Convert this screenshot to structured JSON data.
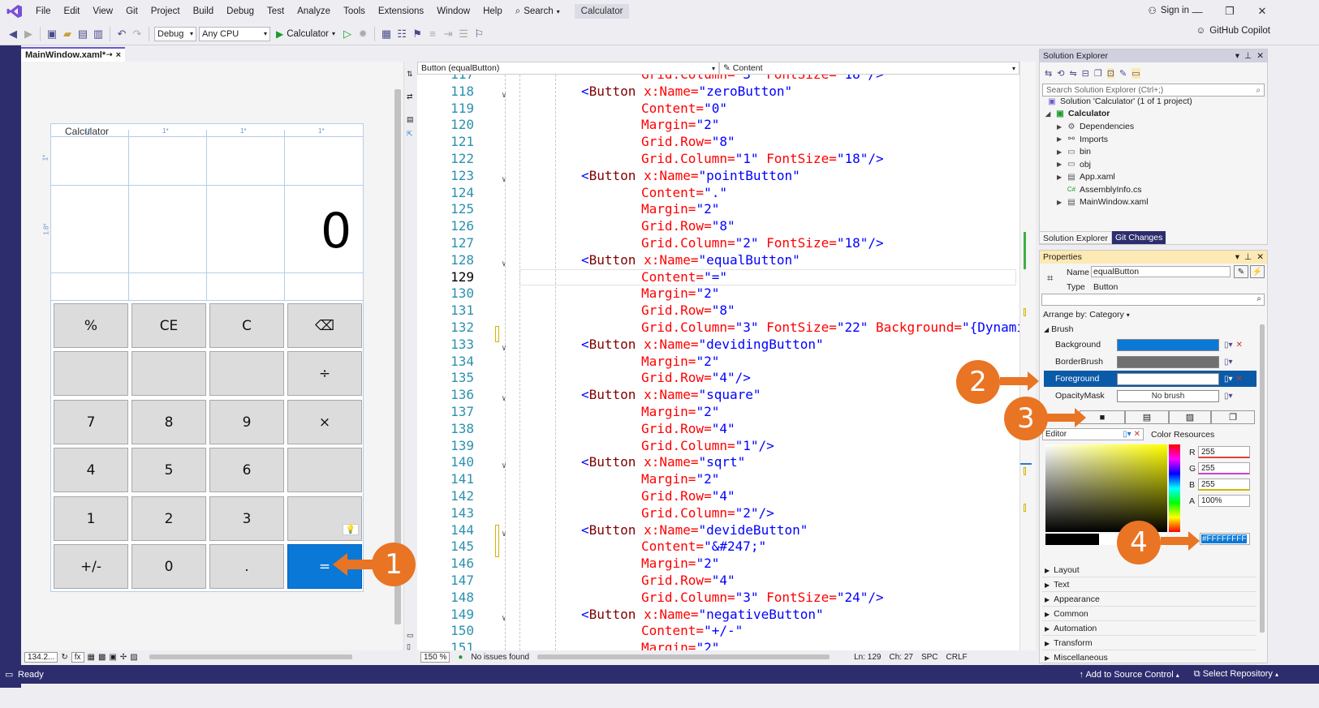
{
  "menu": {
    "items": [
      "File",
      "Edit",
      "View",
      "Git",
      "Project",
      "Build",
      "Debug",
      "Test",
      "Analyze",
      "Tools",
      "Extensions",
      "Window",
      "Help"
    ],
    "search_label": "Search",
    "title_badge": "Calculator",
    "sign_in": "Sign in"
  },
  "toolbar": {
    "config": "Debug",
    "platform": "Any CPU",
    "run_label": "Calculator",
    "copilot": "GitHub Copilot"
  },
  "doc_tab": {
    "label": "MainWindow.xaml*",
    "close": "×"
  },
  "designer": {
    "window_title": "Calculator",
    "display_value": "0",
    "column_markers": [
      "1*",
      "1*",
      "1*",
      "1*"
    ],
    "row_marker_a": "1*",
    "row_marker_b": "1.8*",
    "zoom": "134.2...",
    "buttons": [
      [
        "%",
        "CE",
        "C",
        "⌫"
      ],
      [
        "",
        "",
        "",
        "÷"
      ],
      [
        "7",
        "8",
        "9",
        "×"
      ],
      [
        "4",
        "5",
        "6",
        ""
      ],
      [
        "1",
        "2",
        "3",
        ""
      ],
      [
        "+/-",
        "0",
        ".",
        "="
      ]
    ]
  },
  "editor": {
    "scope_left": "Button (equalButton)",
    "scope_right": "Content",
    "current_line": 129,
    "zoom": "150 %",
    "issues": "No issues found",
    "ln": "Ln: 129",
    "ch": "Ch: 27",
    "spc": "SPC",
    "crlf": "CRLF",
    "lines": [
      {
        "n": "117",
        "parts": [
          [
            "a",
            "Grid.Column="
          ],
          [
            "v",
            "\"3\""
          ],
          [
            "a",
            " FontSize="
          ],
          [
            "v",
            "\"18\""
          ],
          [
            "p",
            "/>"
          ]
        ],
        "indent": 2
      },
      {
        "n": "118",
        "parts": [
          [
            "p",
            "<"
          ],
          [
            "t",
            "Button"
          ],
          [
            "a",
            " x:Name="
          ],
          [
            "v",
            "\"zeroButton\""
          ]
        ],
        "indent": 0,
        "fold": true
      },
      {
        "n": "119",
        "parts": [
          [
            "a",
            "Content="
          ],
          [
            "v",
            "\"0\""
          ]
        ],
        "indent": 2
      },
      {
        "n": "120",
        "parts": [
          [
            "a",
            "Margin="
          ],
          [
            "v",
            "\"2\""
          ]
        ],
        "indent": 2
      },
      {
        "n": "121",
        "parts": [
          [
            "a",
            "Grid.Row="
          ],
          [
            "v",
            "\"8\""
          ]
        ],
        "indent": 2
      },
      {
        "n": "122",
        "parts": [
          [
            "a",
            "Grid.Column="
          ],
          [
            "v",
            "\"1\""
          ],
          [
            "a",
            " FontSize="
          ],
          [
            "v",
            "\"18\""
          ],
          [
            "p",
            "/>"
          ]
        ],
        "indent": 2
      },
      {
        "n": "123",
        "parts": [
          [
            "p",
            "<"
          ],
          [
            "t",
            "Button"
          ],
          [
            "a",
            " x:Name="
          ],
          [
            "v",
            "\"pointButton\""
          ]
        ],
        "indent": 0,
        "fold": true
      },
      {
        "n": "124",
        "parts": [
          [
            "a",
            "Content="
          ],
          [
            "v",
            "\".\""
          ]
        ],
        "indent": 2
      },
      {
        "n": "125",
        "parts": [
          [
            "a",
            "Margin="
          ],
          [
            "v",
            "\"2\""
          ]
        ],
        "indent": 2
      },
      {
        "n": "126",
        "parts": [
          [
            "a",
            "Grid.Row="
          ],
          [
            "v",
            "\"8\""
          ]
        ],
        "indent": 2
      },
      {
        "n": "127",
        "parts": [
          [
            "a",
            "Grid.Column="
          ],
          [
            "v",
            "\"2\""
          ],
          [
            "a",
            " FontSize="
          ],
          [
            "v",
            "\"18\""
          ],
          [
            "p",
            "/>"
          ]
        ],
        "indent": 2
      },
      {
        "n": "128",
        "parts": [
          [
            "p",
            "<"
          ],
          [
            "t",
            "Button"
          ],
          [
            "a",
            " x:Name="
          ],
          [
            "v",
            "\"equalButton\""
          ]
        ],
        "indent": 0,
        "fold": true
      },
      {
        "n": "129",
        "parts": [
          [
            "a",
            "Content="
          ],
          [
            "v",
            "\"=\""
          ]
        ],
        "indent": 2
      },
      {
        "n": "130",
        "parts": [
          [
            "a",
            "Margin="
          ],
          [
            "v",
            "\"2\""
          ]
        ],
        "indent": 2
      },
      {
        "n": "131",
        "parts": [
          [
            "a",
            "Grid.Row="
          ],
          [
            "v",
            "\"8\""
          ]
        ],
        "indent": 2
      },
      {
        "n": "132",
        "parts": [
          [
            "a",
            "Grid.Column="
          ],
          [
            "v",
            "\"3\""
          ],
          [
            "a",
            " FontSize="
          ],
          [
            "v",
            "\"22\""
          ],
          [
            "a",
            " Background="
          ],
          [
            "v",
            "\"{Dynamic"
          ]
        ],
        "indent": 2
      },
      {
        "n": "133",
        "parts": [
          [
            "p",
            "<"
          ],
          [
            "t",
            "Button"
          ],
          [
            "a",
            " x:Name="
          ],
          [
            "v",
            "\"devidingButton\""
          ]
        ],
        "indent": 0,
        "fold": true
      },
      {
        "n": "134",
        "parts": [
          [
            "a",
            "Margin="
          ],
          [
            "v",
            "\"2\""
          ]
        ],
        "indent": 2
      },
      {
        "n": "135",
        "parts": [
          [
            "a",
            "Grid.Row="
          ],
          [
            "v",
            "\"4\""
          ],
          [
            "p",
            "/>"
          ]
        ],
        "indent": 2
      },
      {
        "n": "136",
        "parts": [
          [
            "p",
            "<"
          ],
          [
            "t",
            "Button"
          ],
          [
            "a",
            " x:Name="
          ],
          [
            "v",
            "\"square\""
          ]
        ],
        "indent": 0,
        "fold": true
      },
      {
        "n": "137",
        "parts": [
          [
            "a",
            "Margin="
          ],
          [
            "v",
            "\"2\""
          ]
        ],
        "indent": 2
      },
      {
        "n": "138",
        "parts": [
          [
            "a",
            "Grid.Row="
          ],
          [
            "v",
            "\"4\""
          ]
        ],
        "indent": 2
      },
      {
        "n": "139",
        "parts": [
          [
            "a",
            "Grid.Column="
          ],
          [
            "v",
            "\"1\""
          ],
          [
            "p",
            "/>"
          ]
        ],
        "indent": 2
      },
      {
        "n": "140",
        "parts": [
          [
            "p",
            "<"
          ],
          [
            "t",
            "Button"
          ],
          [
            "a",
            " x:Name="
          ],
          [
            "v",
            "\"sqrt\""
          ]
        ],
        "indent": 0,
        "fold": true
      },
      {
        "n": "141",
        "parts": [
          [
            "a",
            "Margin="
          ],
          [
            "v",
            "\"2\""
          ]
        ],
        "indent": 2
      },
      {
        "n": "142",
        "parts": [
          [
            "a",
            "Grid.Row="
          ],
          [
            "v",
            "\"4\""
          ]
        ],
        "indent": 2
      },
      {
        "n": "143",
        "parts": [
          [
            "a",
            "Grid.Column="
          ],
          [
            "v",
            "\"2\""
          ],
          [
            "p",
            "/>"
          ]
        ],
        "indent": 2
      },
      {
        "n": "144",
        "parts": [
          [
            "p",
            "<"
          ],
          [
            "t",
            "Button"
          ],
          [
            "a",
            " x:Name="
          ],
          [
            "v",
            "\"devideButton\""
          ]
        ],
        "indent": 0,
        "fold": true
      },
      {
        "n": "145",
        "parts": [
          [
            "a",
            "Content="
          ],
          [
            "v",
            "\"&#247;\""
          ]
        ],
        "indent": 2
      },
      {
        "n": "146",
        "parts": [
          [
            "a",
            "Margin="
          ],
          [
            "v",
            "\"2\""
          ]
        ],
        "indent": 2
      },
      {
        "n": "147",
        "parts": [
          [
            "a",
            "Grid.Row="
          ],
          [
            "v",
            "\"4\""
          ]
        ],
        "indent": 2
      },
      {
        "n": "148",
        "parts": [
          [
            "a",
            "Grid.Column="
          ],
          [
            "v",
            "\"3\""
          ],
          [
            "a",
            " FontSize="
          ],
          [
            "v",
            "\"24\""
          ],
          [
            "p",
            "/>"
          ]
        ],
        "indent": 2
      },
      {
        "n": "149",
        "parts": [
          [
            "p",
            "<"
          ],
          [
            "t",
            "Button"
          ],
          [
            "a",
            " x:Name="
          ],
          [
            "v",
            "\"negativeButton\""
          ]
        ],
        "indent": 0,
        "fold": true
      },
      {
        "n": "150",
        "parts": [
          [
            "a",
            "Content="
          ],
          [
            "v",
            "\"+/-\""
          ]
        ],
        "indent": 2
      },
      {
        "n": "151",
        "parts": [
          [
            "a",
            "Margin="
          ],
          [
            "v",
            "\"2\""
          ]
        ],
        "indent": 2
      }
    ]
  },
  "solution_explorer": {
    "title": "Solution Explorer",
    "search_placeholder": "Search Solution Explorer (Ctrl+;)",
    "solution": "Solution 'Calculator' (1 of 1 project)",
    "project": "Calculator",
    "items": [
      "Dependencies",
      "Imports",
      "bin",
      "obj",
      "App.xaml",
      "AssemblyInfo.cs",
      "MainWindow.xaml"
    ],
    "tab_active": "Solution Explorer",
    "tab_inactive": "Git Changes"
  },
  "properties": {
    "title": "Properties",
    "name_label": "Name",
    "name_value": "equalButton",
    "type_label": "Type",
    "type_value": "Button",
    "arrange_by": "Arrange by: Category",
    "brush_category": "Brush",
    "brushes": [
      {
        "name": "Background",
        "color": "#0a78d7"
      },
      {
        "name": "BorderBrush",
        "color": "#707070"
      },
      {
        "name": "Foreground",
        "color": "#ffffff"
      },
      {
        "name": "OpacityMask",
        "value": "No brush"
      }
    ],
    "editor_label": "Editor",
    "color_resources": "Color Resources",
    "r_label": "R",
    "g_label": "G",
    "b_label": "B",
    "a_label": "A",
    "r": "255",
    "g": "255",
    "b": "255",
    "a": "100%",
    "hex": "#FFFFFFFF",
    "categories": [
      "Layout",
      "Text",
      "Appearance",
      "Common",
      "Automation",
      "Transform",
      "Miscellaneous"
    ]
  },
  "callouts": [
    "1",
    "2",
    "3",
    "4"
  ],
  "statusbar": {
    "ready": "Ready",
    "source_control": "Add to Source Control",
    "repository": "Select Repository"
  },
  "colors": {
    "accent": "#2d2d6e",
    "callout": "#e97423",
    "selected_button": "#0a78d7"
  }
}
